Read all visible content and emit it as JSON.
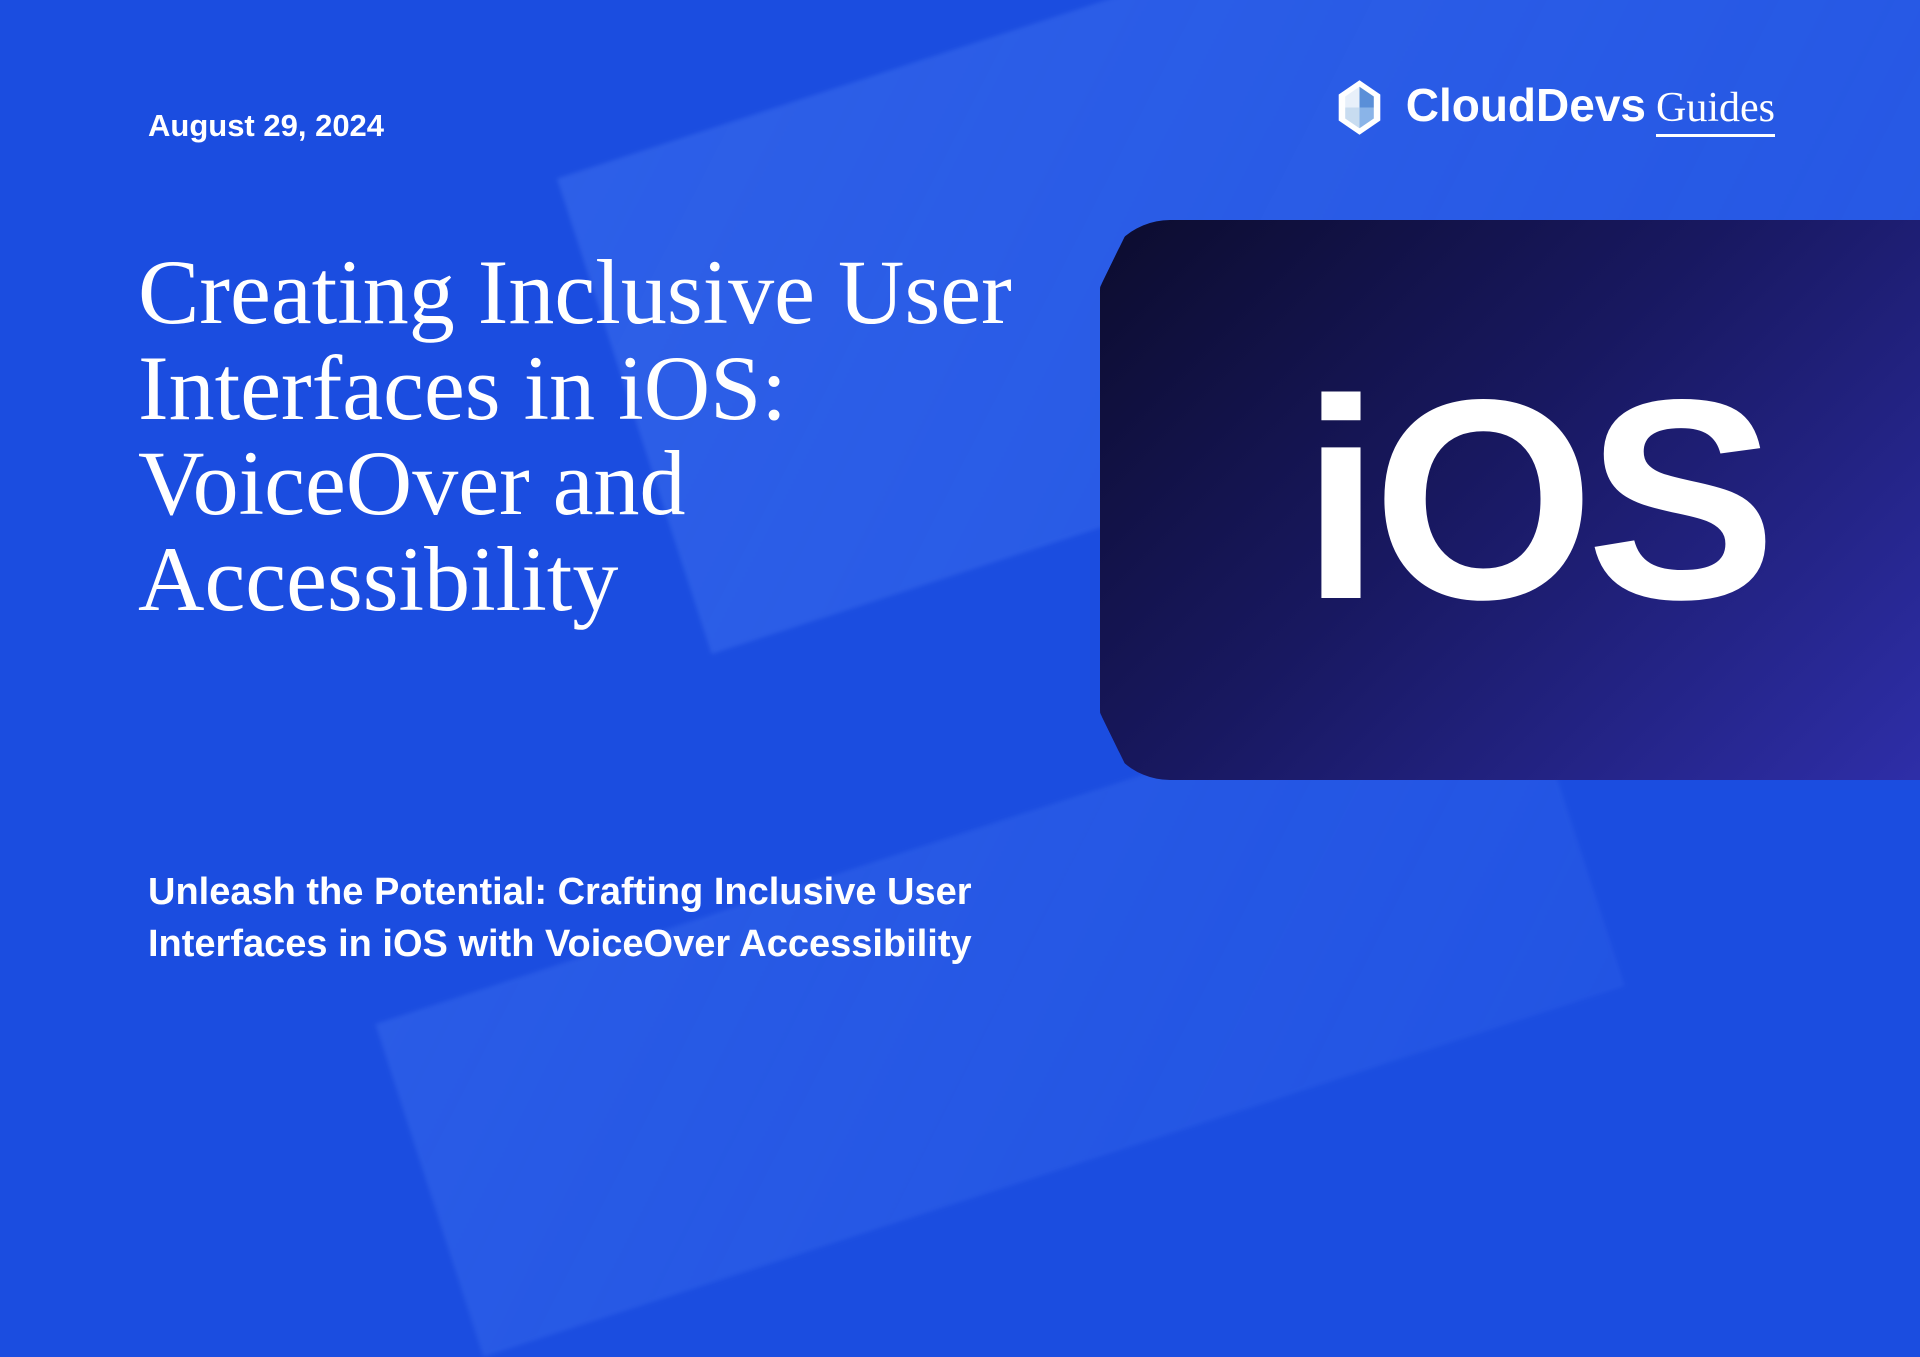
{
  "date": "August 29, 2024",
  "logo": {
    "brand": "CloudDevs",
    "suffix": "Guides"
  },
  "title": "Creating Inclusive User Interfaces in iOS: VoiceOver and Accessibility",
  "subtitle": "Unleash the Potential: Crafting Inclusive User Interfaces in iOS with VoiceOver Accessibility",
  "badge": {
    "text": "iOS"
  }
}
